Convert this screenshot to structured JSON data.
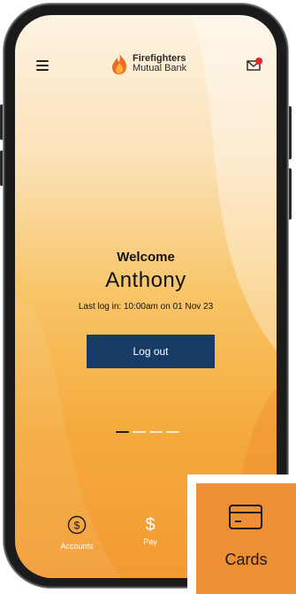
{
  "brand": {
    "name_line1": "Firefighters",
    "name_line2": "Mutual Bank"
  },
  "header": {
    "menu_icon": "hamburger-menu-icon",
    "mail_icon": "mail-with-notification-icon",
    "notification_color": "#e8202a"
  },
  "welcome": {
    "label": "Welcome",
    "user_name": "Anthony",
    "last_login": "Last log in: 10:00am on 01 Nov 23"
  },
  "actions": {
    "logout_label": "Log out"
  },
  "pager": {
    "count": 4,
    "active_index": 0
  },
  "bottom_nav": {
    "accounts": {
      "label": "Accounts",
      "icon": "dollar-circle-icon"
    },
    "pay": {
      "label": "Pay",
      "icon": "dollar-icon",
      "symbol": "$"
    },
    "cards": {
      "label": "Cards",
      "icon": "credit-card-icon"
    }
  },
  "colors": {
    "logout_button": "#163b66",
    "accent_orange": "#ee8f35",
    "flame_orange": "#f26b21"
  }
}
